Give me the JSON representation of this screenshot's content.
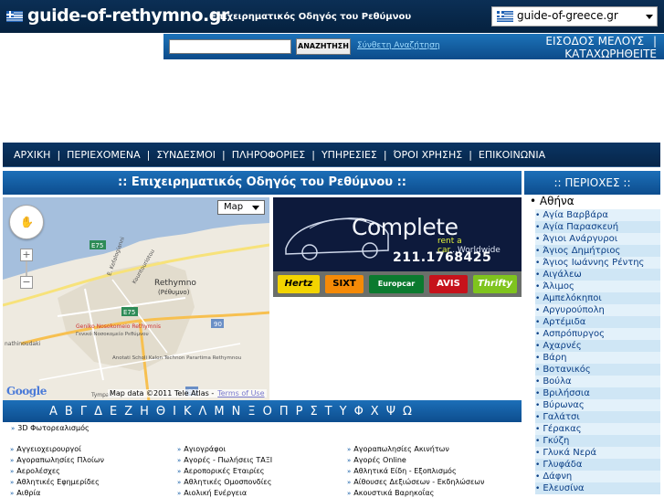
{
  "header": {
    "logo_text": "guide-of-rethymno.gr",
    "tagline": "Επιχειρηματικός Οδηγός του Ρεθύμνου",
    "site_selector": "guide-of-greece.gr"
  },
  "searchbar": {
    "input_value": "",
    "button_label": "ΑΝΑΖΗΤΗΣΗ",
    "advanced_link": "Σύνθετη Αναζήτηση",
    "login_label": "ΕΙΣΟΔΟΣ ΜΕΛΟΥΣ",
    "separator": "|",
    "register_label": "ΚΑΤΑΧΩΡΗΘΕΙΤΕ"
  },
  "nav": {
    "items": [
      "ΑΡΧΙΚΗ",
      "ΠΕΡΙΕΧΟΜΕΝΑ",
      "ΣΥΝΔΕΣΜΟΙ",
      "ΠΛΗΡΟΦΟΡΙΕΣ",
      "ΥΠΗΡΕΣΙΕΣ",
      "ΌΡΟΙ ΧΡΗΣΗΣ",
      "ΕΠΙΚΟΙΝΩΝΙΑ"
    ],
    "separator": "|"
  },
  "main": {
    "heading": ":: Επιχειρηματικός Οδηγός του Ρεθύμνου ::"
  },
  "map": {
    "type_label": "Map",
    "google_label": "Google",
    "attribution": "Map data ©2011 Tele Atlas -",
    "terms_label": "Terms of Use",
    "labels": {
      "rethymno": "Rethymno",
      "rethymno_gr": "(Ρέθυμνο)",
      "e75_a": "E75",
      "e75_b": "E75",
      "r90_a": "90",
      "r90_b": "90",
      "street_kefalogianni": "E. Kefalogianni",
      "street_kountouriotou": "Kountouriotou",
      "hospital": "Geniko Nosokomeio Rethymnis",
      "hospital_gr": "Γενικό Νοσοκομείο Ρεθύμνου",
      "school": "Anotati Scholi Kalon Technon Parartima Rethymnou",
      "tympaki": "Tympaki",
      "athinon": "nathinoudaki"
    }
  },
  "ad": {
    "headline": "Complete",
    "sub_pre": "rent a car",
    "sub_post": "...Worldwide",
    "phone": "211.1768425",
    "brands": [
      "Hertz",
      "SIXT",
      "Europcar",
      "AVIS",
      "Thrifty"
    ]
  },
  "alphabet": [
    "Α",
    "Β",
    "Γ",
    "Δ",
    "Ε",
    "Ζ",
    "Η",
    "Θ",
    "Ι",
    "Κ",
    "Λ",
    "Μ",
    "Ν",
    "Ξ",
    "Ο",
    "Π",
    "Ρ",
    "Σ",
    "Τ",
    "Υ",
    "Φ",
    "Χ",
    "Ψ",
    "Ω"
  ],
  "categories": {
    "featured": "3D Φωτορεαλισμός",
    "bullet": "»",
    "col1": [
      "Αγγειοχειρουργοί",
      "Αγοραπωλησίες Πλοίων",
      "Αερολέσχες",
      "Αθλητικές Εφημερίδες",
      "Αιθρία",
      "Ακτινολόγοι"
    ],
    "col2": [
      "Αγιογράφοι",
      "Αγορές - Πωλήσεις ΤΑΞΙ",
      "Αεροπορικές Εταιρίες",
      "Αθλητικές Ομοσπονδίες",
      "Αιολική Ενέργεια",
      "Αλιευτικές Επιχειρήσεις"
    ],
    "col3": [
      "Αγοραπωλησίες Ακινήτων",
      "Αγορές Online",
      "Αθλητικά Είδη - Εξοπλισμός",
      "Αίθουσες Δεξιώσεων - Εκδηλώσεων",
      "Ακουστικά Βαρηκοΐας",
      "Αλλεργιολόγοι"
    ]
  },
  "sidebar": {
    "heading": ":: ΠΕΡΙΟΧΕΣ ::",
    "region": "• Αθήνα",
    "areas": [
      "Αγία Βαρβάρα",
      "Αγία Παρασκευή",
      "Άγιοι Ανάργυροι",
      "Άγιος Δημήτριος",
      "Άγιος Ιωάννης Ρέντης",
      "Αιγάλεω",
      "Άλιμος",
      "Αμπελόκηποι",
      "Αργυρούπολη",
      "Αρτέμιδα",
      "Ασπρόπυργος",
      "Αχαρνές",
      "Βάρη",
      "Βοτανικός",
      "Βούλα",
      "Βριλήσσια",
      "Βύρωνας",
      "Γαλάτσι",
      "Γέρακας",
      "Γκύζη",
      "Γλυκά Νερά",
      "Γλυφάδα",
      "Δάφνη",
      "Ελευσίνα"
    ]
  },
  "colors": {
    "header_bg": "#0b2f55",
    "blue_bar": "#1c6fb8",
    "nav_bg": "#0a3564",
    "link_blue": "#0b3f86",
    "area_bg": "#cfe6f5"
  }
}
